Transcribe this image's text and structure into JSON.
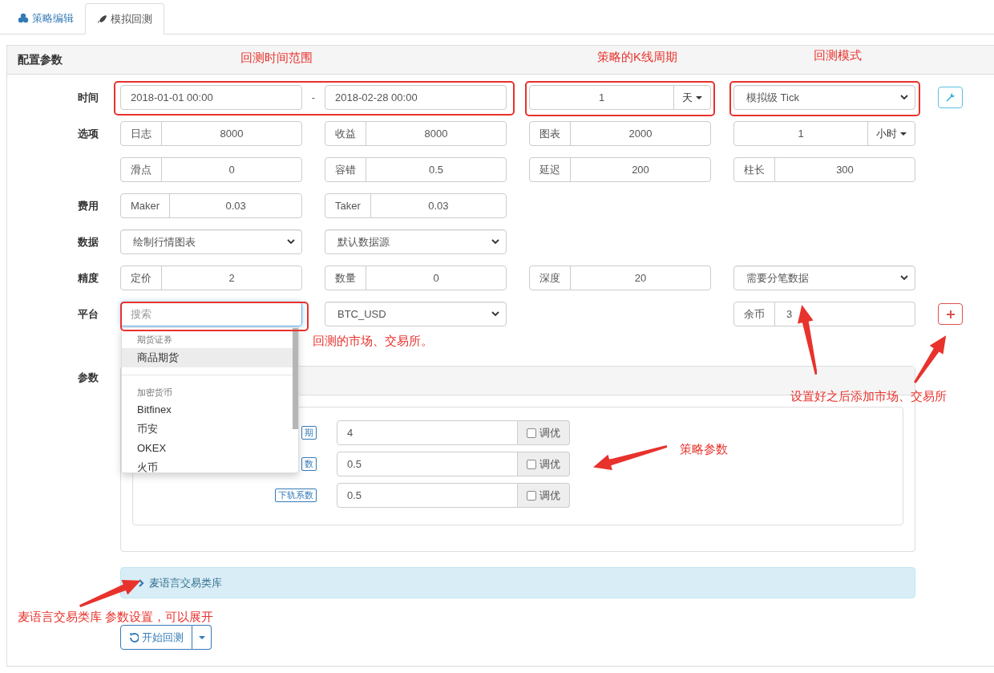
{
  "tabs": [
    {
      "label": "策略编辑",
      "selected": false
    },
    {
      "label": "模拟回测",
      "selected": true
    }
  ],
  "panel": {
    "title": "配置参数"
  },
  "rows": [
    {
      "label": "时间",
      "cells": [
        {
          "kind": "date-range",
          "from": "2018-01-01 00:00",
          "separator": "-",
          "to": "2018-02-28 00:00"
        },
        {
          "kind": "number-unit",
          "value": "1",
          "unit": "天"
        },
        {
          "kind": "select",
          "value": "模拟级 Tick"
        },
        {
          "kind": "tool-button"
        }
      ]
    },
    {
      "label": "选项",
      "cells": [
        {
          "kind": "addon",
          "addon": "日志",
          "value": "8000"
        },
        {
          "kind": "addon",
          "addon": "收益",
          "value": "8000"
        },
        {
          "kind": "addon",
          "addon": "图表",
          "value": "2000"
        },
        {
          "kind": "number-unit",
          "value": "1",
          "unit": "小时"
        }
      ]
    },
    {
      "cells": [
        {
          "kind": "addon",
          "addon": "滑点",
          "value": "0"
        },
        {
          "kind": "addon",
          "addon": "容错",
          "value": "0.5"
        },
        {
          "kind": "addon",
          "addon": "延迟",
          "value": "200"
        },
        {
          "kind": "addon",
          "addon": "柱长",
          "value": "300"
        }
      ]
    },
    {
      "label": "费用",
      "cells": [
        {
          "kind": "addon",
          "addon": "Maker",
          "value": "0.03"
        },
        {
          "kind": "addon",
          "addon": "Taker",
          "value": "0.03"
        }
      ]
    },
    {
      "label": "数据",
      "cells": [
        {
          "kind": "select",
          "value": "绘制行情图表"
        },
        {
          "kind": "select",
          "value": "默认数据源"
        }
      ]
    },
    {
      "label": "精度",
      "cells": [
        {
          "kind": "addon",
          "addon": "定价",
          "value": "2"
        },
        {
          "kind": "addon",
          "addon": "数量",
          "value": "0"
        },
        {
          "kind": "addon",
          "addon": "深度",
          "value": "20"
        },
        {
          "kind": "select",
          "value": "需要分笔数据"
        }
      ]
    },
    {
      "label": "平台",
      "cells": [
        {
          "kind": "search",
          "placeholder": "搜索"
        },
        {
          "kind": "select",
          "value": "BTC_USD"
        },
        {
          "kind": "blank"
        },
        {
          "kind": "text-addon",
          "addon": "余币",
          "value": "3"
        },
        {
          "kind": "add-button"
        }
      ]
    }
  ],
  "dropdown": {
    "groups": [
      {
        "heading": "期货证券",
        "items": [
          {
            "label": "商品期货",
            "selected": true
          }
        ]
      },
      {
        "heading": "加密货币",
        "items": [
          {
            "label": "Bitfinex",
            "selected": false
          },
          {
            "label": "币安",
            "selected": false
          },
          {
            "label": "OKEX",
            "selected": false
          },
          {
            "label": "火币",
            "selected": false
          }
        ]
      }
    ]
  },
  "params": {
    "label": "参数",
    "rows": [
      {
        "label": "期",
        "value": "4",
        "optimize": {
          "label": "调优",
          "checked": false
        }
      },
      {
        "label": "数",
        "value": "0.5",
        "optimize": {
          "label": "调优",
          "checked": false
        }
      },
      {
        "label": "下轨系数",
        "value": "0.5",
        "optimize": {
          "label": "调优",
          "checked": false
        }
      }
    ]
  },
  "library": {
    "label": "麦语言交易类库",
    "expanded": false
  },
  "start_button": {
    "label": "开始回测"
  },
  "annotations": [
    {
      "text": "回测时间范围"
    },
    {
      "text": "策略的K线周期"
    },
    {
      "text": "回测模式"
    },
    {
      "text": "回测的市场、交易所。"
    },
    {
      "text": "设置好之后添加市场、交易所"
    },
    {
      "text": "策略参数"
    },
    {
      "text": "麦语言交易类库 参数设置，可以展开"
    }
  ]
}
